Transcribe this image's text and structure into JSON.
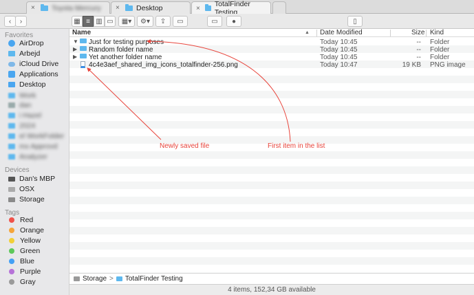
{
  "tabs": [
    {
      "label": "Toyota Mercury",
      "blurred": true
    },
    {
      "label": "Desktop",
      "blurred": false
    },
    {
      "label": "TotalFinder Testing",
      "blurred": false,
      "active": true
    }
  ],
  "sidebar": {
    "favorites_header": "Favorites",
    "favorites": [
      {
        "label": "AirDrop",
        "icon": "airdrop-icon",
        "blurred": false
      },
      {
        "label": "Arbejd",
        "icon": "folder-icon",
        "blurred": false
      },
      {
        "label": "iCloud Drive",
        "icon": "cloud-icon",
        "blurred": false
      },
      {
        "label": "Applications",
        "icon": "applications-icon",
        "blurred": false
      },
      {
        "label": "Desktop",
        "icon": "desktop-icon",
        "blurred": false
      },
      {
        "label": "Work",
        "icon": "folder-icon",
        "blurred": true
      },
      {
        "label": "dan",
        "icon": "home-icon",
        "blurred": true
      },
      {
        "label": "i Hazel",
        "icon": "folder-icon",
        "blurred": true
      },
      {
        "label": "2024",
        "icon": "folder-icon",
        "blurred": true
      },
      {
        "label": "el WorkFolder",
        "icon": "folder-icon",
        "blurred": true
      },
      {
        "label": "mx Approvd",
        "icon": "folder-icon",
        "blurred": true
      },
      {
        "label": "Analyzer",
        "icon": "folder-icon",
        "blurred": true
      }
    ],
    "devices_header": "Devices",
    "devices": [
      {
        "label": "Dan's MBP",
        "icon": "laptop-icon"
      },
      {
        "label": "OSX",
        "icon": "disk-icon"
      },
      {
        "label": "Storage",
        "icon": "external-disk-icon"
      }
    ],
    "tags_header": "Tags",
    "tags": [
      {
        "label": "Red",
        "color": "#f0524a"
      },
      {
        "label": "Orange",
        "color": "#f5a53a"
      },
      {
        "label": "Yellow",
        "color": "#f2cf37"
      },
      {
        "label": "Green",
        "color": "#5dc85a"
      },
      {
        "label": "Blue",
        "color": "#43a0f5"
      },
      {
        "label": "Purple",
        "color": "#b672d8"
      },
      {
        "label": "Gray",
        "color": "#9a9a9a"
      }
    ]
  },
  "columns": {
    "name": "Name",
    "date": "Date Modified",
    "size": "Size",
    "kind": "Kind"
  },
  "files": [
    {
      "name": "Just for testing purposes",
      "date": "Today 10:45",
      "size": "--",
      "kind": "Folder",
      "type": "folder",
      "expanded": true
    },
    {
      "name": "Random folder name",
      "date": "Today 10:45",
      "size": "--",
      "kind": "Folder",
      "type": "folder",
      "expanded": false
    },
    {
      "name": "Yet another folder name",
      "date": "Today 10:45",
      "size": "--",
      "kind": "Folder",
      "type": "folder",
      "expanded": false
    },
    {
      "name": "4c4e3aef_shared_img_icons_totalfinder-256.png",
      "date": "Today 10:47",
      "size": "19 KB",
      "kind": "PNG image",
      "type": "png"
    }
  ],
  "path": {
    "disk": "Storage",
    "sep": ">",
    "folder": "TotalFinder Testing"
  },
  "status": "4 items, 152,34 GB available",
  "annotations": {
    "saved": "Newly saved file",
    "first": "First item in the list"
  },
  "colors": {
    "annotation": "#e8433a",
    "folder": "#5eb8ee",
    "selected": "#6b6b6b"
  }
}
